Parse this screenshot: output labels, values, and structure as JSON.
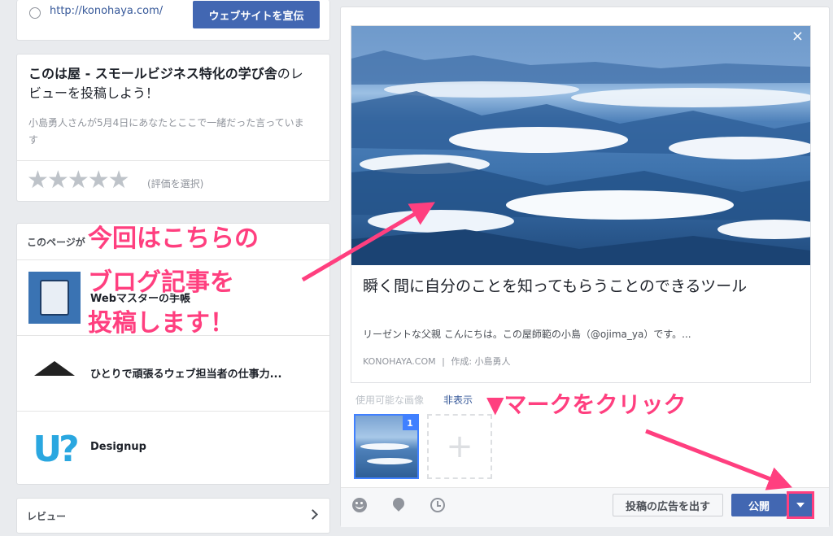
{
  "top_card": {
    "url": "http://konohaya.com/",
    "promote_button": "ウェブサイトを宣伝"
  },
  "review_card": {
    "title_bold": "このは屋 - スモールビジネス特化の学び舎",
    "title_rest": "のレビューを投稿しよう！",
    "subtitle": "小島勇人さんが5月4日にあなたとここで一緒だった言っています",
    "rating_hint": "(評価を選択)"
  },
  "pages_card": {
    "header": "このページが",
    "items": [
      {
        "name": "Webマスターの手帳"
      },
      {
        "name": "ひとりで頑張るウェブ担当者の仕事力..."
      },
      {
        "name": "Designup"
      }
    ]
  },
  "reviews_card": {
    "label": "レビュー"
  },
  "link_preview": {
    "title": "瞬く間に自分のことを知ってもらうことのできるツール",
    "description": "リーゼントな父親 こんにちは。この屋師範の小島（@ojima_ya）です。...",
    "domain": "KONOHAYA.COM",
    "separator": "|",
    "author": "作成: 小島勇人"
  },
  "images": {
    "label": "使用可能な画像",
    "hide_link": "非表示",
    "badge": "1",
    "add_symbol": "+"
  },
  "composer_footer": {
    "boost_button": "投稿の広告を出す",
    "publish_button": "公開"
  },
  "annotations": {
    "line1": "今回はこちらの",
    "line2": "ブログ記事を",
    "line3": "投稿します！",
    "click_hint": "▼マークをクリック"
  },
  "colors": {
    "accent": "#4267b2",
    "annotation": "#ff3f7f"
  }
}
